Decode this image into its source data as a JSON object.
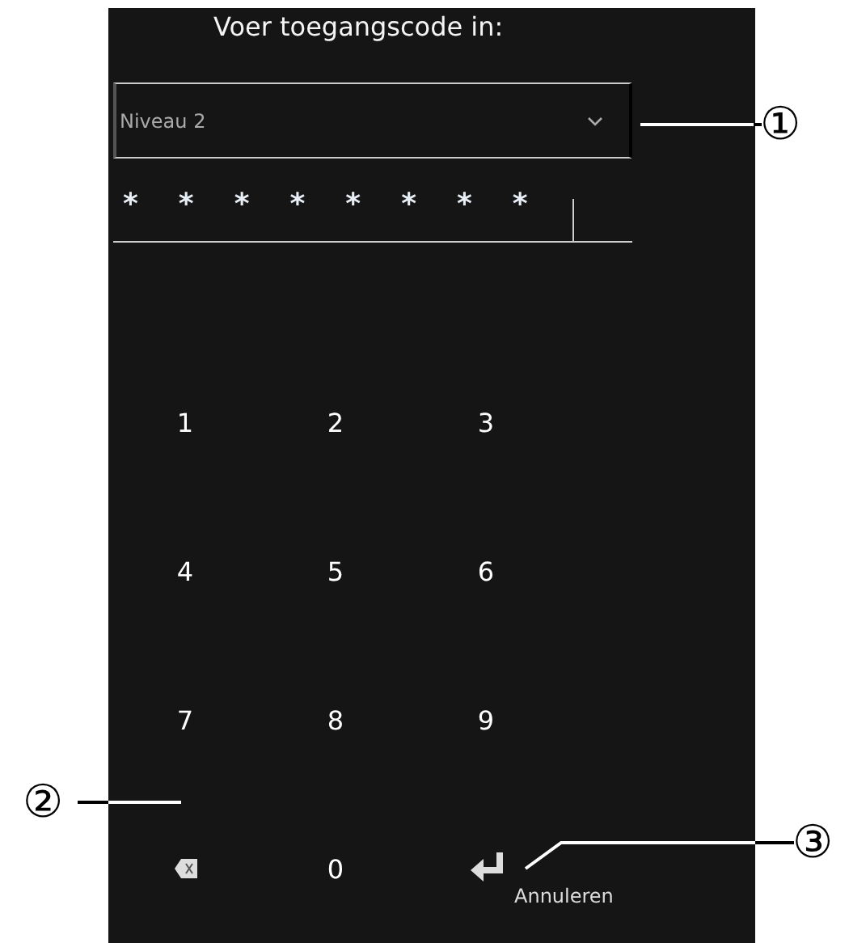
{
  "title": "Voer toegangscode in:",
  "level_select": {
    "value": "Niveau 2"
  },
  "code_field": {
    "value": "********"
  },
  "keypad": [
    {
      "kind": "digit",
      "label": "1"
    },
    {
      "kind": "digit",
      "label": "2"
    },
    {
      "kind": "digit",
      "label": "3"
    },
    {
      "kind": "digit",
      "label": "4"
    },
    {
      "kind": "digit",
      "label": "5"
    },
    {
      "kind": "digit",
      "label": "6"
    },
    {
      "kind": "digit",
      "label": "7"
    },
    {
      "kind": "digit",
      "label": "8"
    },
    {
      "kind": "digit",
      "label": "9"
    },
    {
      "kind": "backspace"
    },
    {
      "kind": "digit",
      "label": "0"
    },
    {
      "kind": "enter"
    }
  ],
  "cancel_button": "Annuleren",
  "callouts": [
    "①",
    "②",
    "③"
  ]
}
